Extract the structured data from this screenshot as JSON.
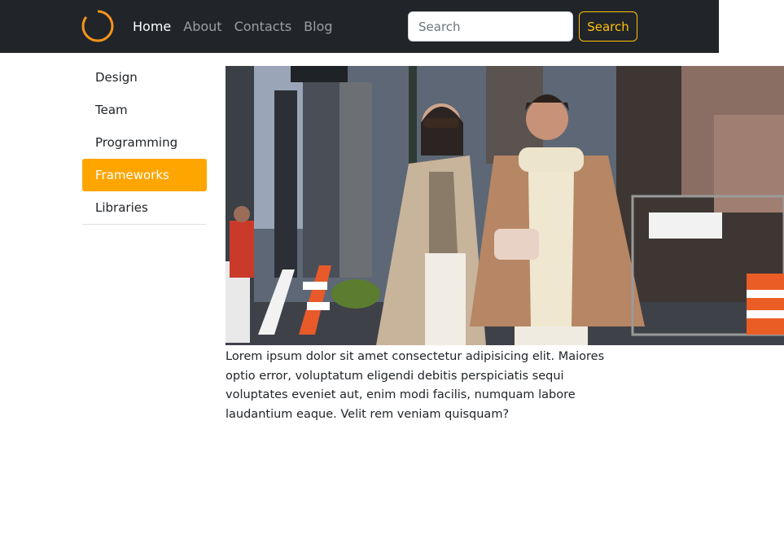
{
  "navbar": {
    "links": [
      {
        "label": "Home",
        "active": true
      },
      {
        "label": "About",
        "active": false
      },
      {
        "label": "Contacts",
        "active": false
      },
      {
        "label": "Blog",
        "active": false
      }
    ],
    "search": {
      "placeholder": "Search",
      "value": "",
      "button_label": "Search"
    }
  },
  "sidebar": {
    "items": [
      {
        "label": "Design",
        "active": false
      },
      {
        "label": "Team",
        "active": false
      },
      {
        "label": "Programming",
        "active": false
      },
      {
        "label": "Frameworks",
        "active": true
      },
      {
        "label": "Libraries",
        "active": false
      }
    ]
  },
  "main": {
    "paragraph": "Lorem ipsum dolor sit amet consectetur adipisicing elit. Maiores optio error, voluptatum eligendi debitis perspiciatis sequi voluptates eveniet aut, enim modi facilis, numquam labore laudantium eaque. Velit rem veniam quisquam?"
  },
  "colors": {
    "navbar_bg": "#212529",
    "accent": "#ffa500",
    "search_button": "#ffc107",
    "logo_ring": "#f7941d"
  },
  "icons": {
    "logo": "ring-logo-icon"
  }
}
